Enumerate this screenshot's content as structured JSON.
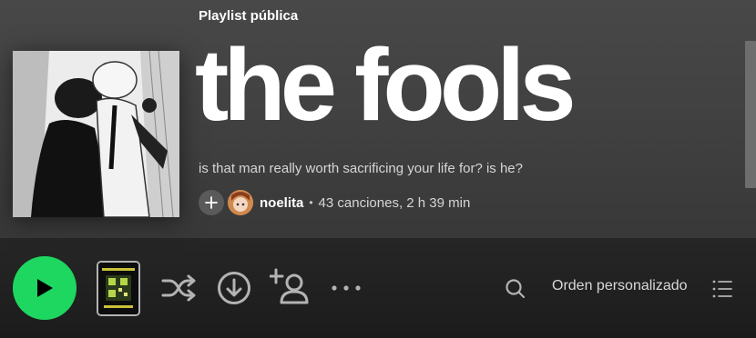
{
  "playlist": {
    "type_label": "Playlist pública",
    "title": "the fools",
    "description": "is that man really worth sacrificing your life for? is he?",
    "owner": "noelita",
    "separator": "•",
    "stats": "43 canciones, 2 h 39 min"
  },
  "actions": {
    "sort_label": "Orden personalizado"
  },
  "icons": {
    "add": "plus-icon",
    "play": "play-icon",
    "shuffle": "shuffle-icon",
    "download": "download-icon",
    "add_user": "add-user-icon",
    "more": "more-icon",
    "search": "search-icon",
    "list": "list-icon"
  },
  "colors": {
    "accent": "#1ed760",
    "header_bg": "#444444",
    "body_bg": "#121212"
  }
}
